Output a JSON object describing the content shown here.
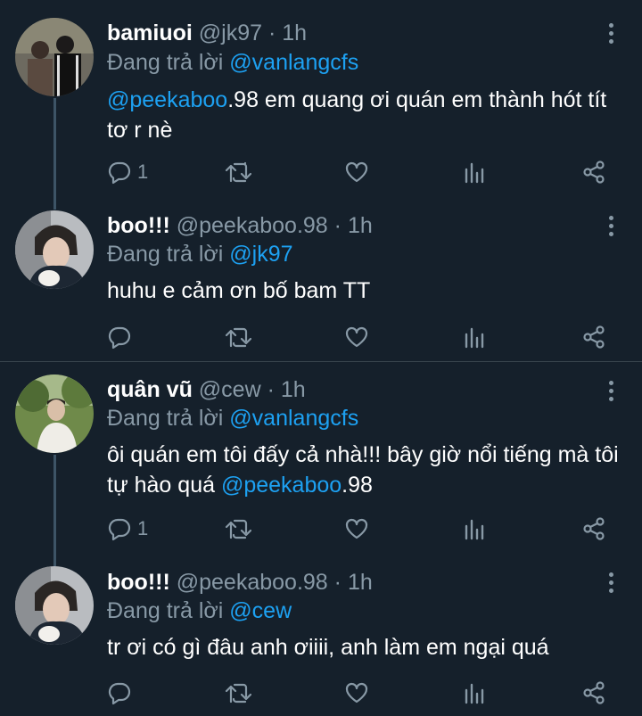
{
  "colors": {
    "background": "#15202b",
    "name": "#ffffff",
    "secondary": "#8899a6",
    "mention": "#1da1f2",
    "divider": "#38444d"
  },
  "tweets": [
    {
      "name": "bamiuoi",
      "handle": "@jk97",
      "time": "· 1h",
      "reply_prefix": "Đang trả lời",
      "reply_to": "@vanlangcfs",
      "body_mention": "@peekaboo",
      "body_rest": ".98 em quang ơi quán em thành hót tít tơ r nè",
      "reply_count": "1"
    },
    {
      "name": "boo!!!",
      "handle": "@peekaboo.98",
      "time": "· 1h",
      "reply_prefix": "Đang trả lời",
      "reply_to": "@jk97",
      "body_text": "huhu e cảm ơn bố bam TT",
      "reply_count": ""
    },
    {
      "name": "quân vũ",
      "handle": "@cew",
      "time": "· 1h",
      "reply_prefix": "Đang trả lời",
      "reply_to": "@vanlangcfs",
      "body_text": "ôi quán em tôi đấy cả nhà!!! bây giờ nổi tiếng mà tôi tự hào quá ",
      "body_mention": "@peekaboo",
      "body_rest": ".98",
      "reply_count": "1"
    },
    {
      "name": "boo!!!",
      "handle": "@peekaboo.98",
      "time": "· 1h",
      "reply_prefix": "Đang trả lời",
      "reply_to": "@cew",
      "body_text": "tr ơi có gì đâu anh ơiiii, anh làm em ngại quá",
      "reply_count": ""
    }
  ]
}
